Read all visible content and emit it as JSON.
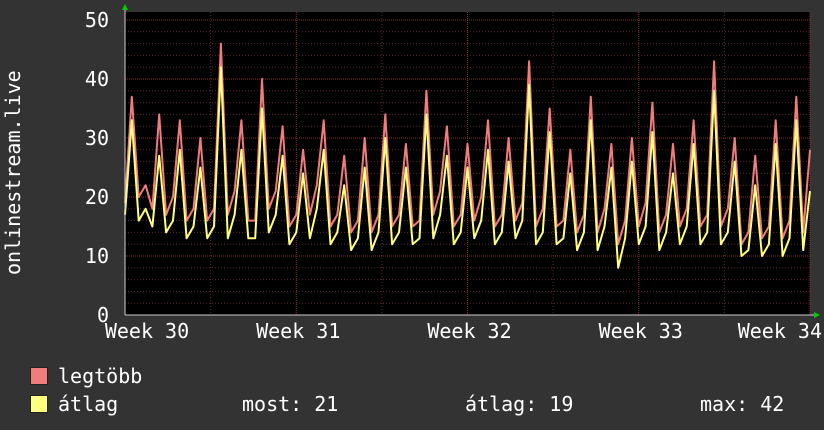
{
  "chart_data": {
    "type": "line",
    "ylabel": "onlinestream.live",
    "ylim": [
      0,
      50
    ],
    "yticks": [
      "0",
      "10",
      "20",
      "30",
      "40",
      "50"
    ],
    "xlim": [
      30,
      34
    ],
    "xticks": [
      "Week 30",
      "Week 31",
      "Week 32",
      "Week 33",
      "Week 34"
    ],
    "grid": true,
    "series": [
      {
        "name": "legtöbb",
        "color": "#f07c7c",
        "x": [
          30.0,
          30.04,
          30.08,
          30.12,
          30.16,
          30.2,
          30.24,
          30.28,
          30.32,
          30.36,
          30.4,
          30.44,
          30.48,
          30.52,
          30.56,
          30.6,
          30.64,
          30.68,
          30.72,
          30.76,
          30.8,
          30.84,
          30.88,
          30.92,
          30.96,
          31.0,
          31.04,
          31.08,
          31.12,
          31.16,
          31.2,
          31.24,
          31.28,
          31.32,
          31.36,
          31.4,
          31.44,
          31.48,
          31.52,
          31.56,
          31.6,
          31.64,
          31.68,
          31.72,
          31.76,
          31.8,
          31.84,
          31.88,
          31.92,
          31.96,
          32.0,
          32.04,
          32.08,
          32.12,
          32.16,
          32.2,
          32.24,
          32.28,
          32.32,
          32.36,
          32.4,
          32.44,
          32.48,
          32.52,
          32.56,
          32.6,
          32.64,
          32.68,
          32.72,
          32.76,
          32.8,
          32.84,
          32.88,
          32.92,
          32.96,
          33.0,
          33.04,
          33.08,
          33.12,
          33.16,
          33.2,
          33.24,
          33.28,
          33.32,
          33.36,
          33.4,
          33.44,
          33.48,
          33.52,
          33.56,
          33.6,
          33.64,
          33.68,
          33.72,
          33.76,
          33.8,
          33.84,
          33.88,
          33.92,
          33.96,
          34.0
        ],
        "values": [
          19,
          37,
          20,
          22,
          18,
          34,
          17,
          20,
          33,
          16,
          18,
          30,
          16,
          18,
          46,
          17,
          21,
          33,
          16,
          16,
          40,
          18,
          21,
          32,
          15,
          17,
          28,
          17,
          22,
          33,
          15,
          17,
          27,
          14,
          16,
          30,
          14,
          17,
          34,
          15,
          17,
          29,
          15,
          16,
          38,
          17,
          21,
          32,
          15,
          17,
          29,
          16,
          20,
          33,
          15,
          17,
          30,
          16,
          19,
          43,
          15,
          18,
          35,
          15,
          16,
          28,
          14,
          17,
          37,
          14,
          18,
          29,
          12,
          16,
          30,
          15,
          19,
          36,
          14,
          17,
          29,
          15,
          18,
          33,
          15,
          17,
          43,
          15,
          18,
          30,
          12,
          14,
          27,
          13,
          15,
          33,
          13,
          16,
          37,
          14,
          28
        ]
      },
      {
        "name": "átlag",
        "color": "#ffff80",
        "x": [
          30.0,
          30.04,
          30.08,
          30.12,
          30.16,
          30.2,
          30.24,
          30.28,
          30.32,
          30.36,
          30.4,
          30.44,
          30.48,
          30.52,
          30.56,
          30.6,
          30.64,
          30.68,
          30.72,
          30.76,
          30.8,
          30.84,
          30.88,
          30.92,
          30.96,
          31.0,
          31.04,
          31.08,
          31.12,
          31.16,
          31.2,
          31.24,
          31.28,
          31.32,
          31.36,
          31.4,
          31.44,
          31.48,
          31.52,
          31.56,
          31.6,
          31.64,
          31.68,
          31.72,
          31.76,
          31.8,
          31.84,
          31.88,
          31.92,
          31.96,
          32.0,
          32.04,
          32.08,
          32.12,
          32.16,
          32.2,
          32.24,
          32.28,
          32.32,
          32.36,
          32.4,
          32.44,
          32.48,
          32.52,
          32.56,
          32.6,
          32.64,
          32.68,
          32.72,
          32.76,
          32.8,
          32.84,
          32.88,
          32.92,
          32.96,
          33.0,
          33.04,
          33.08,
          33.12,
          33.16,
          33.2,
          33.24,
          33.28,
          33.32,
          33.36,
          33.4,
          33.44,
          33.48,
          33.52,
          33.56,
          33.6,
          33.64,
          33.68,
          33.72,
          33.76,
          33.8,
          33.84,
          33.88,
          33.92,
          33.96,
          34.0
        ],
        "values": [
          17,
          33,
          16,
          18,
          15,
          27,
          14,
          16,
          28,
          13,
          15,
          25,
          13,
          15,
          42,
          13,
          17,
          28,
          13,
          13,
          35,
          14,
          17,
          27,
          12,
          14,
          24,
          13,
          18,
          28,
          12,
          14,
          22,
          11,
          13,
          25,
          11,
          14,
          30,
          12,
          14,
          25,
          12,
          13,
          34,
          13,
          17,
          27,
          12,
          14,
          25,
          13,
          16,
          28,
          12,
          14,
          26,
          13,
          16,
          39,
          12,
          14,
          31,
          12,
          13,
          24,
          11,
          14,
          33,
          11,
          15,
          25,
          8,
          13,
          26,
          12,
          15,
          31,
          11,
          14,
          24,
          12,
          15,
          29,
          12,
          14,
          38,
          12,
          14,
          26,
          10,
          11,
          22,
          10,
          12,
          29,
          10,
          13,
          33,
          11,
          21
        ]
      }
    ],
    "legend": {
      "position": "bottom-left",
      "items": [
        {
          "label": "legtöbb",
          "color": "#f07c7c"
        },
        {
          "label": "átlag",
          "color": "#ffff80"
        }
      ],
      "stats": {
        "now": "most: 21",
        "avg": "átlag: 19",
        "max": "max: 42"
      }
    },
    "colors": {
      "background": "#333333",
      "plot_background": "#000000",
      "grid_minor": "#5a2a2a",
      "axis_arrow": "#00cc00"
    }
  }
}
